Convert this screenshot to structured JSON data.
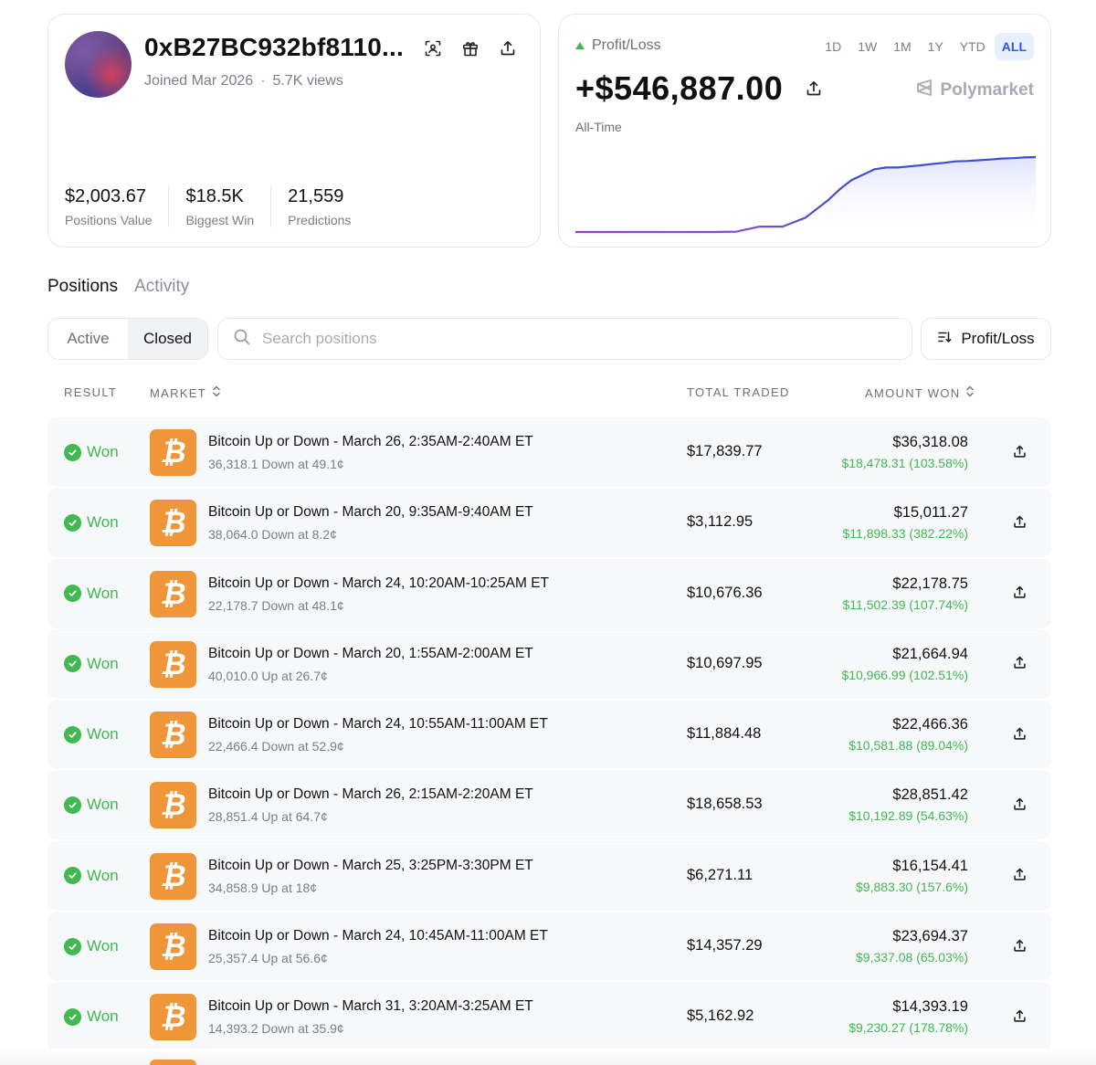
{
  "profile": {
    "address": "0xB27BC932bf8110...",
    "joined": "Joined Mar 2026",
    "views": "5.7K views",
    "stats": [
      {
        "value": "$2,003.67",
        "label": "Positions Value"
      },
      {
        "value": "$18.5K",
        "label": "Biggest Win"
      },
      {
        "value": "21,559",
        "label": "Predictions"
      }
    ],
    "icons": [
      "scan-icon",
      "gift-icon",
      "share-icon"
    ]
  },
  "pnl": {
    "label": "Profit/Loss",
    "value": "+$546,887.00",
    "period_label": "All-Time",
    "brand": "Polymarket",
    "ranges": [
      "1D",
      "1W",
      "1M",
      "1Y",
      "YTD",
      "ALL"
    ],
    "active_range": "ALL",
    "colors": {
      "line_start": "#8e44c8",
      "line_end": "#3b4fd0",
      "fill": "#e6e9ff"
    }
  },
  "chart_data": {
    "type": "area",
    "x": [
      0,
      20,
      40,
      60,
      70,
      80,
      90,
      100,
      110,
      115,
      120,
      125,
      130,
      135,
      140,
      145,
      150,
      155,
      160,
      165,
      170,
      175,
      180,
      185,
      190,
      195,
      200
    ],
    "values": [
      0,
      0,
      0,
      0,
      1,
      15,
      15,
      40,
      90,
      120,
      145,
      160,
      175,
      180,
      180,
      183,
      186,
      190,
      193,
      197,
      198,
      200,
      202,
      205,
      206,
      208,
      209
    ],
    "grid": false
  },
  "tabs": [
    {
      "label": "Positions",
      "active": true
    },
    {
      "label": "Activity",
      "active": false
    }
  ],
  "filters": {
    "segments": [
      {
        "label": "Active",
        "active": false
      },
      {
        "label": "Closed",
        "active": true
      }
    ],
    "search_placeholder": "Search positions",
    "sort_label": "Profit/Loss"
  },
  "table": {
    "headers": {
      "result": "RESULT",
      "market": "MARKET",
      "total_traded": "TOTAL TRADED",
      "amount_won": "AMOUNT WON"
    },
    "rows": [
      {
        "result": "Won",
        "title": "Bitcoin Up or Down - March 26, 2:35AM-2:40AM ET",
        "sub": "36,318.1 Down at 49.1¢",
        "traded": "$17,839.77",
        "won": "$36,318.08",
        "gain": "$18,478.31 (103.58%)"
      },
      {
        "result": "Won",
        "title": "Bitcoin Up or Down - March 20, 9:35AM-9:40AM ET",
        "sub": "38,064.0 Down at 8.2¢",
        "traded": "$3,112.95",
        "won": "$15,011.27",
        "gain": "$11,898.33 (382.22%)"
      },
      {
        "result": "Won",
        "title": "Bitcoin Up or Down - March 24, 10:20AM-10:25AM ET",
        "sub": "22,178.7 Down at 48.1¢",
        "traded": "$10,676.36",
        "won": "$22,178.75",
        "gain": "$11,502.39 (107.74%)"
      },
      {
        "result": "Won",
        "title": "Bitcoin Up or Down - March 20, 1:55AM-2:00AM ET",
        "sub": "40,010.0 Up at 26.7¢",
        "traded": "$10,697.95",
        "won": "$21,664.94",
        "gain": "$10,966.99 (102.51%)"
      },
      {
        "result": "Won",
        "title": "Bitcoin Up or Down - March 24, 10:55AM-11:00AM ET",
        "sub": "22,466.4 Down at 52.9¢",
        "traded": "$11,884.48",
        "won": "$22,466.36",
        "gain": "$10,581.88 (89.04%)"
      },
      {
        "result": "Won",
        "title": "Bitcoin Up or Down - March 26, 2:15AM-2:20AM ET",
        "sub": "28,851.4 Up at 64.7¢",
        "traded": "$18,658.53",
        "won": "$28,851.42",
        "gain": "$10,192.89 (54.63%)"
      },
      {
        "result": "Won",
        "title": "Bitcoin Up or Down - March 25, 3:25PM-3:30PM ET",
        "sub": "34,858.9 Up at 18¢",
        "traded": "$6,271.11",
        "won": "$16,154.41",
        "gain": "$9,883.30 (157.6%)"
      },
      {
        "result": "Won",
        "title": "Bitcoin Up or Down - March 24, 10:45AM-11:00AM ET",
        "sub": "25,357.4 Up at 56.6¢",
        "traded": "$14,357.29",
        "won": "$23,694.37",
        "gain": "$9,337.08 (65.03%)"
      },
      {
        "result": "Won",
        "title": "Bitcoin Up or Down - March 31, 3:20AM-3:25AM ET",
        "sub": "14,393.2 Down at 35.9¢",
        "traded": "$5,162.92",
        "won": "$14,393.19",
        "gain": "$9,230.27 (178.78%)"
      }
    ],
    "market_icon": "bitcoin-icon",
    "market_icon_glyph": "₿",
    "colors": {
      "won": "#3fb950",
      "bitcoin": "#f0963a"
    }
  }
}
